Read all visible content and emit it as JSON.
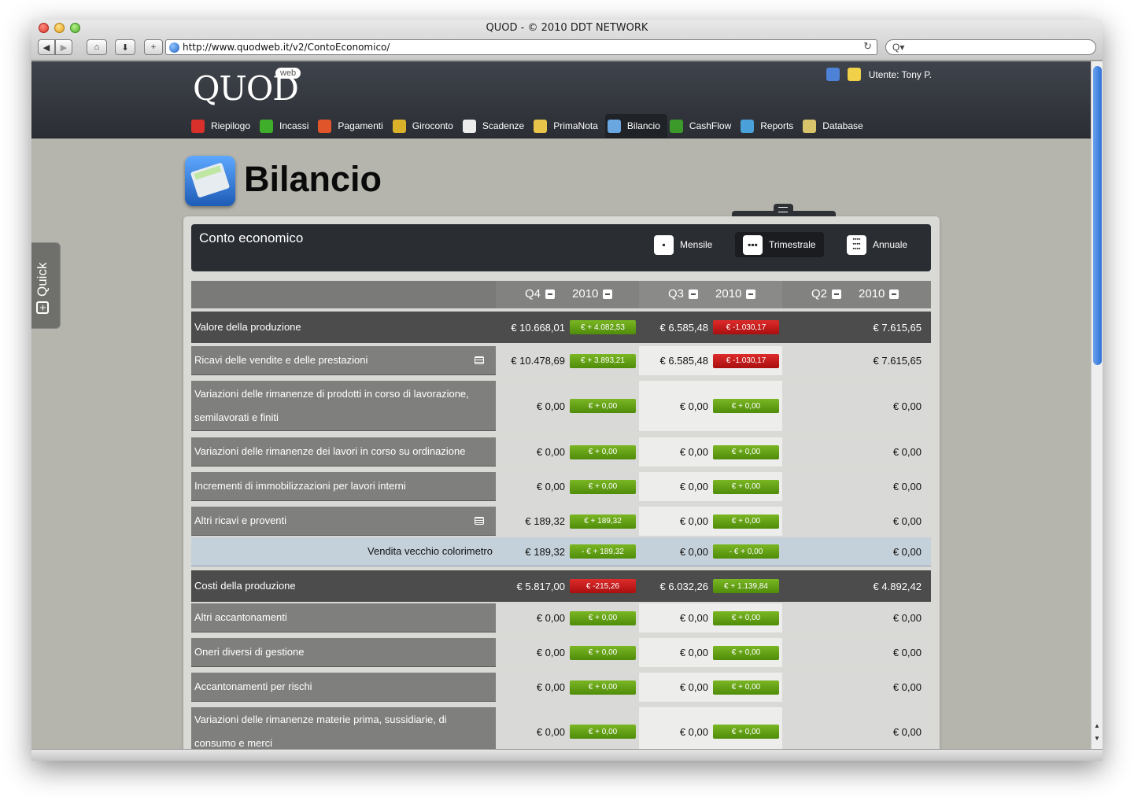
{
  "window": {
    "title": "QUOD - © 2010 DDT NETWORK"
  },
  "browser": {
    "url": "http://www.quodweb.it/v2/ContoEconomico/",
    "search_placeholder": "Q▾"
  },
  "header": {
    "logo": "QUOD",
    "logo_badge": "web",
    "user_label": "Utente: Tony P.",
    "nav": [
      {
        "label": "Riepilogo",
        "color": "#d9302b"
      },
      {
        "label": "Incassi",
        "color": "#3fae2a"
      },
      {
        "label": "Pagamenti",
        "color": "#e0562a"
      },
      {
        "label": "Giroconto",
        "color": "#d9b22a"
      },
      {
        "label": "Scadenze",
        "color": "#ececec"
      },
      {
        "label": "PrimaNota",
        "color": "#e8c44a"
      },
      {
        "label": "Bilancio",
        "color": "#6aa6e0"
      },
      {
        "label": "CashFlow",
        "color": "#3b9a2a"
      },
      {
        "label": "Reports",
        "color": "#4aa0d8"
      },
      {
        "label": "Database",
        "color": "#d8c46a"
      }
    ]
  },
  "sidebar": {
    "quick_label": "Quick"
  },
  "page": {
    "title": "Bilancio"
  },
  "panel": {
    "title": "Conto economico",
    "periods": [
      "Mensile",
      "Trimestrale",
      "Annuale"
    ],
    "active_period": "Trimestrale"
  },
  "columns": [
    {
      "quarter": "Q4",
      "year": "2010"
    },
    {
      "quarter": "Q3",
      "year": "2010"
    },
    {
      "quarter": "Q2",
      "year": "2010"
    }
  ],
  "rows": [
    {
      "type": "hdr",
      "label": "Valore della produzione",
      "v1": "€ 10.668,01",
      "d1": "€ + 4.082,53",
      "s1": "g",
      "v2": "€ 6.585,48",
      "d2": "€ -1.030,17",
      "s2": "r",
      "v3": "€ 7.615,65"
    },
    {
      "type": "sub",
      "label": "Ricavi delle vendite e delle prestazioni",
      "note": true,
      "v1": "€ 10.478,69",
      "d1": "€ + 3.893,21",
      "s1": "g",
      "v2": "€ 6.585,48",
      "d2": "€ -1.030,17",
      "s2": "r",
      "v3": "€ 7.615,65"
    },
    {
      "type": "sub",
      "label": "Variazioni delle rimanenze di prodotti in corso di lavorazione, semilavorati e finiti",
      "v1": "€ 0,00",
      "d1": "€ + 0,00",
      "s1": "g",
      "v2": "€ 0,00",
      "d2": "€ + 0,00",
      "s2": "g",
      "v3": "€ 0,00"
    },
    {
      "type": "sub",
      "label": "Variazioni delle rimanenze dei lavori in corso su ordinazione",
      "v1": "€ 0,00",
      "d1": "€ + 0,00",
      "s1": "g",
      "v2": "€ 0,00",
      "d2": "€ + 0,00",
      "s2": "g",
      "v3": "€ 0,00"
    },
    {
      "type": "sub",
      "label": "Incrementi di immobilizzazioni per lavori interni",
      "v1": "€ 0,00",
      "d1": "€ + 0,00",
      "s1": "g",
      "v2": "€ 0,00",
      "d2": "€ + 0,00",
      "s2": "g",
      "v3": "€ 0,00"
    },
    {
      "type": "sub",
      "label": "Altri ricavi e proventi",
      "note": true,
      "v1": "€ 189,32",
      "d1": "€ + 189,32",
      "s1": "g",
      "v2": "€ 0,00",
      "d2": "€ + 0,00",
      "s2": "g",
      "v3": "€ 0,00"
    },
    {
      "type": "det",
      "label": "Vendita vecchio colorimetro",
      "v1": "€ 189,32",
      "d1": "- € + 189,32",
      "s1": "g",
      "v2": "€ 0,00",
      "d2": "- € + 0,00",
      "s2": "g",
      "v3": "€ 0,00"
    },
    {
      "type": "hdr",
      "label": "Costi della produzione",
      "v1": "€ 5.817,00",
      "d1": "€ -215,26",
      "s1": "r",
      "v2": "€ 6.032,26",
      "d2": "€ + 1.139,84",
      "s2": "g",
      "v3": "€ 4.892,42"
    },
    {
      "type": "sub",
      "label": "Altri accantonamenti",
      "v1": "€ 0,00",
      "d1": "€ + 0,00",
      "s1": "g",
      "v2": "€ 0,00",
      "d2": "€ + 0,00",
      "s2": "g",
      "v3": "€ 0,00"
    },
    {
      "type": "sub",
      "label": "Oneri diversi di gestione",
      "v1": "€ 0,00",
      "d1": "€ + 0,00",
      "s1": "g",
      "v2": "€ 0,00",
      "d2": "€ + 0,00",
      "s2": "g",
      "v3": "€ 0,00"
    },
    {
      "type": "sub",
      "label": "Accantonamenti per rischi",
      "v1": "€ 0,00",
      "d1": "€ + 0,00",
      "s1": "g",
      "v2": "€ 0,00",
      "d2": "€ + 0,00",
      "s2": "g",
      "v3": "€ 0,00"
    },
    {
      "type": "sub",
      "label": "Variazioni delle rimanenze materie prima, sussidiarie, di consumo e merci",
      "v1": "€ 0,00",
      "d1": "€ + 0,00",
      "s1": "g",
      "v2": "€ 0,00",
      "d2": "€ + 0,00",
      "s2": "g",
      "v3": "€ 0,00"
    }
  ]
}
